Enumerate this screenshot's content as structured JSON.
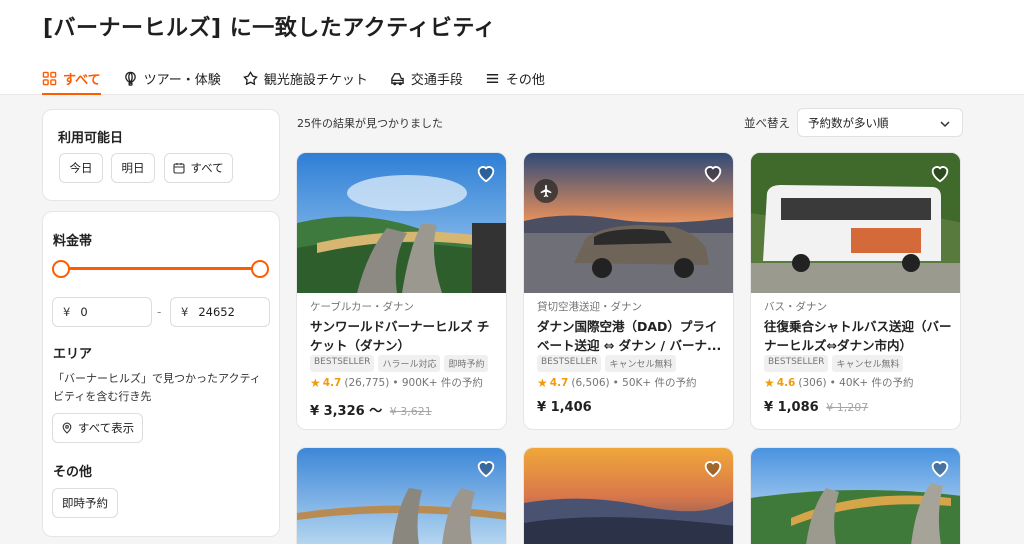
{
  "page": {
    "title": "[バーナーヒルズ] に一致したアクティビティ"
  },
  "tabs": [
    {
      "label": "すべて",
      "icon": "grid-icon",
      "active": true
    },
    {
      "label": "ツアー・体験",
      "icon": "balloon-icon"
    },
    {
      "label": "観光施設チケット",
      "icon": "attraction-icon"
    },
    {
      "label": "交通手段",
      "icon": "transport-icon"
    },
    {
      "label": "その他",
      "icon": "menu-icon"
    }
  ],
  "filters": {
    "date": {
      "title": "利用可能日",
      "options": [
        "今日",
        "明日",
        "すべて"
      ]
    },
    "price": {
      "title": "料金帯",
      "currency": "¥",
      "min": "0",
      "max": "24652"
    },
    "area": {
      "title": "エリア",
      "description": "「バーナーヒルズ」で見つかったアクティビティを含む行き先",
      "show_all": "すべて表示"
    },
    "other": {
      "title": "その他",
      "instant": "即時予約"
    }
  },
  "results": {
    "count_text": "25件の結果が見つかりました",
    "sort_label": "並べ替え",
    "sort_value": "予約数が多い順"
  },
  "products": [
    {
      "category": "ケーブルカー・ダナン",
      "name": "サンワールドバーナーヒルズ チケット（ダナン）",
      "badges": [
        "BESTSELLER",
        "ハラール対応",
        "即時予約"
      ],
      "rating": "4.7",
      "reviews": "(26,775)",
      "booked": "• 900K+ 件の予約",
      "price": "¥ 3,326 〜",
      "old_price": "¥ 3,621"
    },
    {
      "category": "貸切空港送迎・ダナン",
      "name": "ダナン国際空港（DAD）プライベート送迎 ⇔ ダナン / バーナ...",
      "badges": [
        "BESTSELLER",
        "キャンセル無料"
      ],
      "rating": "4.7",
      "reviews": "(6,506)",
      "booked": "• 50K+ 件の予約",
      "price": "¥ 1,406",
      "old_price": ""
    },
    {
      "category": "バス・ダナン",
      "name": "往復乗合シャトルバス送迎（バーナーヒルズ⇔ダナン市内）",
      "badges": [
        "BESTSELLER",
        "キャンセル無料"
      ],
      "rating": "4.6",
      "reviews": "(306)",
      "booked": "• 40K+ 件の予約",
      "price": "¥ 1,086",
      "old_price": "¥ 1,207"
    }
  ],
  "colors": {
    "accent": "#ff5b00",
    "star": "#f09b0a"
  }
}
